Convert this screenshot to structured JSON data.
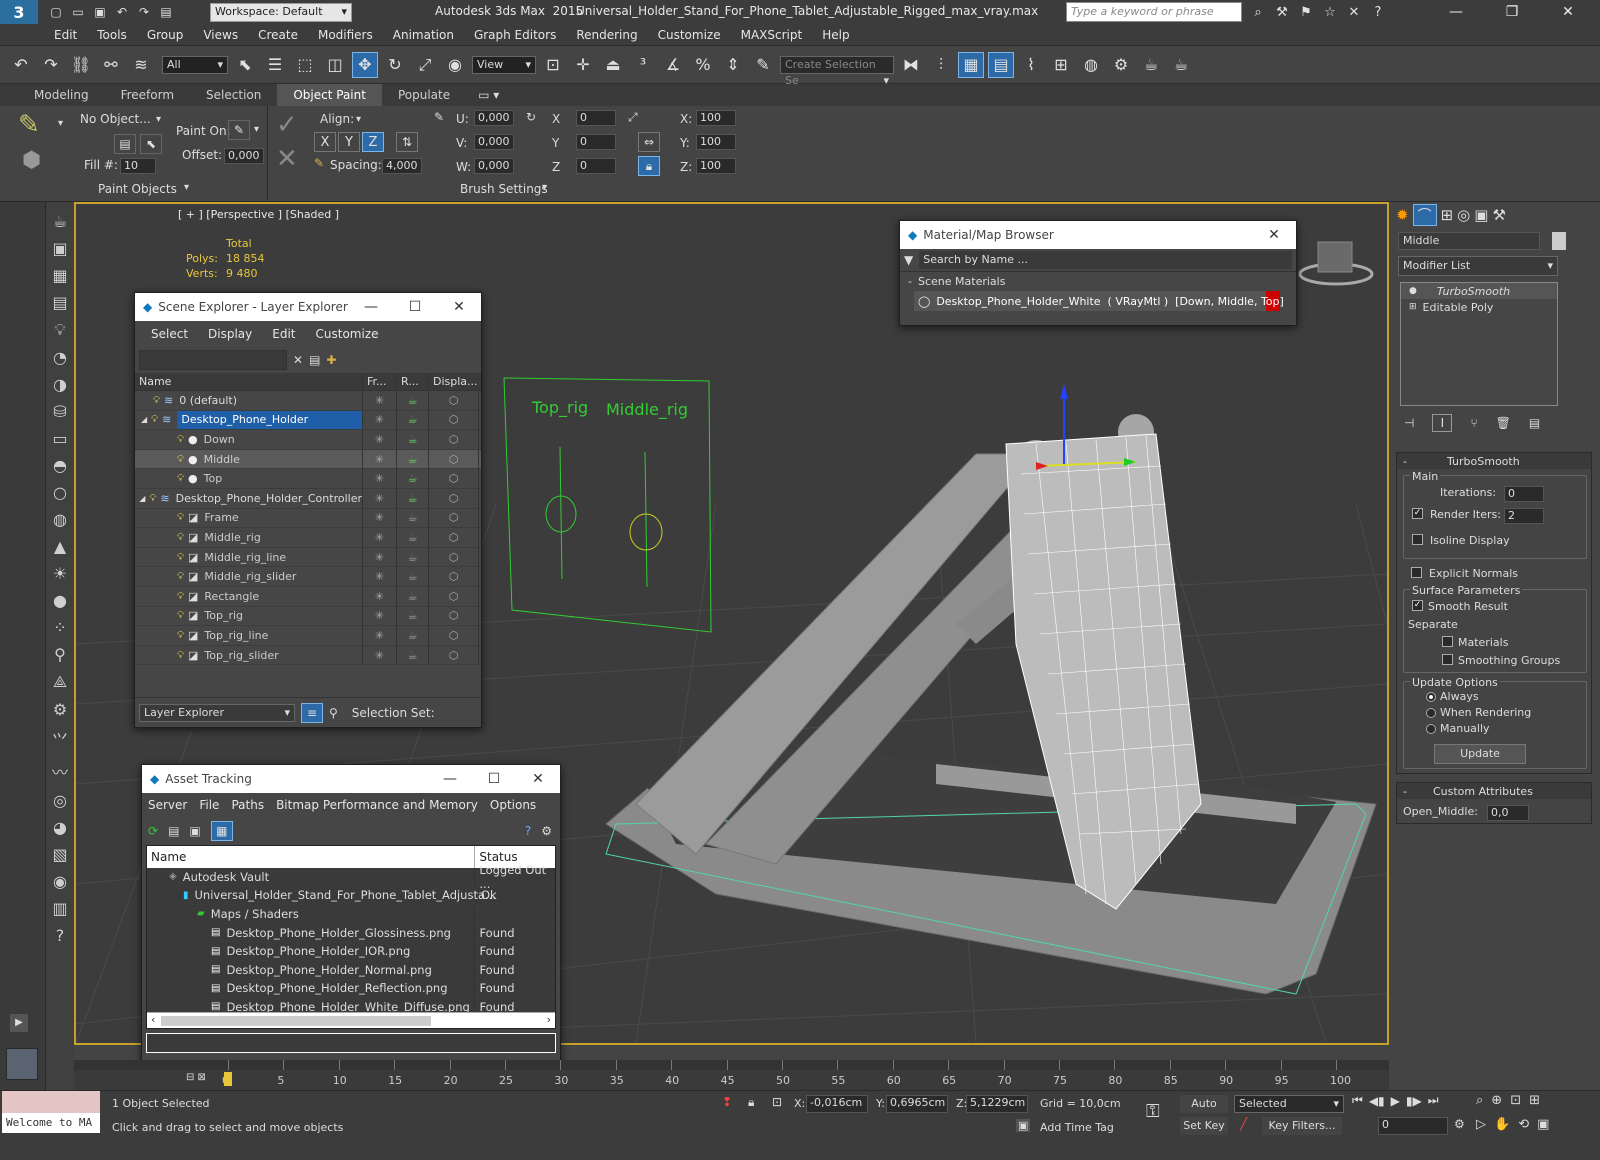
{
  "titlebar": {
    "app": "Autodesk 3ds Max  2015",
    "file": "Universal_Holder_Stand_For_Phone_Tablet_Adjustable_Rigged_max_vray.max",
    "workspace": "Workspace: Default",
    "search_placeholder": "Type a keyword or phrase"
  },
  "menu": [
    "Edit",
    "Tools",
    "Group",
    "Views",
    "Create",
    "Modifiers",
    "Animation",
    "Graph Editors",
    "Rendering",
    "Customize",
    "MAXScript",
    "Help"
  ],
  "toolbar": {
    "filter": "All",
    "refcoord": "View",
    "selset": "Create Selection Se"
  },
  "ribbon_tabs": [
    "Modeling",
    "Freeform",
    "Selection",
    "Object Paint",
    "Populate"
  ],
  "ribbon_active": "Object Paint",
  "ribbon": {
    "no_object": "No Object...",
    "paint_on": "Paint On:",
    "offset_label": "Offset:",
    "offset": "0,000",
    "fill_label": "Fill #:",
    "fill": "10",
    "paint_objects": "Paint Objects",
    "align_label": "Align:",
    "x": "X",
    "y": "Y",
    "z": "Z",
    "spacing_label": "Spacing:",
    "spacing": "4,000",
    "u_label": "U:",
    "u": "0,000",
    "v_label": "V:",
    "v": "0,000",
    "w_label": "W:",
    "w": "0,000",
    "rx_label": "X",
    "rx": "0",
    "ry_label": "Y",
    "ry": "0",
    "rz_label": "Z",
    "rz": "0",
    "sx_label": "X:",
    "sx": "100",
    "sy_label": "Y:",
    "sy": "100",
    "sz_label": "Z:",
    "sz": "100",
    "brush_settings": "Brush Settings"
  },
  "viewport": {
    "label": "[ + ] [Perspective ] [Shaded ]",
    "total": "Total",
    "polys_label": "Polys:",
    "polys": "18 854",
    "verts_label": "Verts:",
    "verts": "9 480",
    "rig_top": "Top_rig",
    "rig_middle": "Middle_rig"
  },
  "scene_explorer": {
    "title": "Scene Explorer - Layer Explorer",
    "menu": [
      "Select",
      "Display",
      "Edit",
      "Customize"
    ],
    "cols": [
      "Name",
      "Fr...",
      "R...",
      "Displa..."
    ],
    "rows": [
      {
        "name": "0 (default)",
        "indent": 1,
        "type": "layer"
      },
      {
        "name": "Desktop_Phone_Holder",
        "indent": 1,
        "type": "layer",
        "sel": true
      },
      {
        "name": "Down",
        "indent": 2,
        "type": "obj"
      },
      {
        "name": "Middle",
        "indent": 2,
        "type": "obj",
        "hl": true
      },
      {
        "name": "Top",
        "indent": 2,
        "type": "obj"
      },
      {
        "name": "Desktop_Phone_Holder_Controller",
        "indent": 1,
        "type": "layer"
      },
      {
        "name": "Frame",
        "indent": 2,
        "type": "shape"
      },
      {
        "name": "Middle_rig",
        "indent": 2,
        "type": "shape"
      },
      {
        "name": "Middle_rig_line",
        "indent": 2,
        "type": "shape"
      },
      {
        "name": "Middle_rig_slider",
        "indent": 2,
        "type": "shape"
      },
      {
        "name": "Rectangle",
        "indent": 2,
        "type": "shape"
      },
      {
        "name": "Top_rig",
        "indent": 2,
        "type": "shape"
      },
      {
        "name": "Top_rig_line",
        "indent": 2,
        "type": "shape"
      },
      {
        "name": "Top_rig_slider",
        "indent": 2,
        "type": "shape"
      }
    ],
    "footer_combo": "Layer Explorer",
    "selection_set": "Selection Set:"
  },
  "material_browser": {
    "title": "Material/Map Browser",
    "search": "Search by Name ...",
    "section": "Scene Materials",
    "item": "Desktop_Phone_Holder_White  ( VRayMtl )  [Down, Middle, Top]"
  },
  "asset_tracking": {
    "title": "Asset Tracking",
    "menu": [
      "Server",
      "File",
      "Paths",
      "Bitmap Performance and Memory",
      "Options"
    ],
    "cols": [
      "Name",
      "Status"
    ],
    "rows": [
      {
        "name": "Autodesk Vault",
        "status": "Logged Out ...",
        "indent": 0
      },
      {
        "name": "Universal_Holder_Stand_For_Phone_Tablet_Adjusta...",
        "status": "Ok",
        "indent": 1
      },
      {
        "name": "Maps / Shaders",
        "status": "",
        "indent": 2
      },
      {
        "name": "Desktop_Phone_Holder_Glossiness.png",
        "status": "Found",
        "indent": 3
      },
      {
        "name": "Desktop_Phone_Holder_IOR.png",
        "status": "Found",
        "indent": 3
      },
      {
        "name": "Desktop_Phone_Holder_Normal.png",
        "status": "Found",
        "indent": 3
      },
      {
        "name": "Desktop_Phone_Holder_Reflection.png",
        "status": "Found",
        "indent": 3
      },
      {
        "name": "Desktop_Phone_Holder_White_Diffuse.png",
        "status": "Found",
        "indent": 3
      }
    ]
  },
  "cmdpanel": {
    "object_name": "Middle",
    "modifier_list": "Modifier List",
    "stack": [
      "TurboSmooth",
      "Editable Poly"
    ],
    "turbosmooth": "TurboSmooth",
    "main": "Main",
    "iterations_label": "Iterations:",
    "iterations": "0",
    "render_iters_label": "Render Iters:",
    "render_iters": "2",
    "isoline": "Isoline Display",
    "explicit": "Explicit Normals",
    "surface": "Surface Parameters",
    "smooth_result": "Smooth Result",
    "separate": "Separate",
    "materials": "Materials",
    "smoothing_groups": "Smoothing Groups",
    "update_options": "Update Options",
    "always": "Always",
    "when_rendering": "When Rendering",
    "manually": "Manually",
    "update": "Update",
    "custom_attr": "Custom Attributes",
    "open_middle_label": "Open_Middle:",
    "open_middle": "0,0"
  },
  "timeline": {
    "ticks": [
      "0",
      "5",
      "10",
      "15",
      "20",
      "25",
      "30",
      "35",
      "40",
      "45",
      "50",
      "55",
      "60",
      "65",
      "70",
      "75",
      "80",
      "85",
      "90",
      "95",
      "100"
    ],
    "frame": "0 / 100"
  },
  "status": {
    "welcome": "Welcome to MA",
    "selected": "1 Object Selected",
    "hint": "Click and drag to select and move objects",
    "x_label": "X:",
    "x": "-0,016cm",
    "y_label": "Y:",
    "y": "0,6965cm",
    "z_label": "Z:",
    "z": "5,1229cm",
    "grid": "Grid = 10,0cm",
    "add_time_tag": "Add Time Tag",
    "auto_key": "Auto Key",
    "set_key": "Set Key",
    "selected_combo": "Selected",
    "key_filters": "Key Filters...",
    "frame_val": "0"
  },
  "colors": {
    "accent": "#1f5fa8",
    "viewport_border": "#c8a02c",
    "rig_green": "#33cc33"
  }
}
